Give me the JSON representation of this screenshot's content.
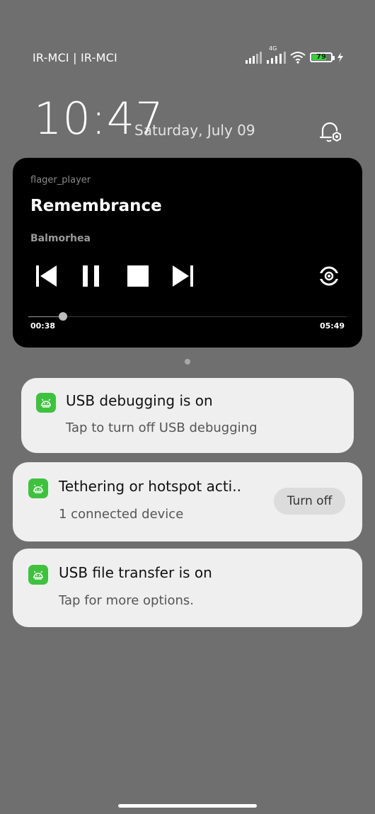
{
  "status_bar": {
    "carrier": "IR-MCI | IR-MCI",
    "network_type": "4G",
    "battery_percent": "79",
    "battery_level": 0.79,
    "charging": true
  },
  "lockscreen": {
    "time": "10:47",
    "date": "Saturday, July 09"
  },
  "media": {
    "app": "flager_player",
    "title": "Remembrance",
    "artist": "Balmorhea",
    "elapsed": "00:38",
    "duration": "05:49",
    "progress_fraction": 0.109,
    "controls": [
      "skip-previous-icon",
      "pause-icon",
      "stop-icon",
      "skip-next-icon",
      "cast-icon"
    ]
  },
  "notifications": [
    {
      "title": "USB debugging is on",
      "body": "Tap to turn off USB debugging",
      "icon": "android-icon"
    },
    {
      "title": "Tethering or hotspot acti..",
      "body": "1 connected device",
      "action": "Turn off",
      "icon": "android-icon"
    },
    {
      "title": "USB file transfer is on",
      "body": "Tap for more options.",
      "icon": "android-icon"
    }
  ],
  "colors": {
    "background": "#6f6f6f",
    "media_card": "#000000",
    "notification_card": "#efefef",
    "app_icon": "#3ec23e",
    "battery_fill": "#39d039"
  }
}
